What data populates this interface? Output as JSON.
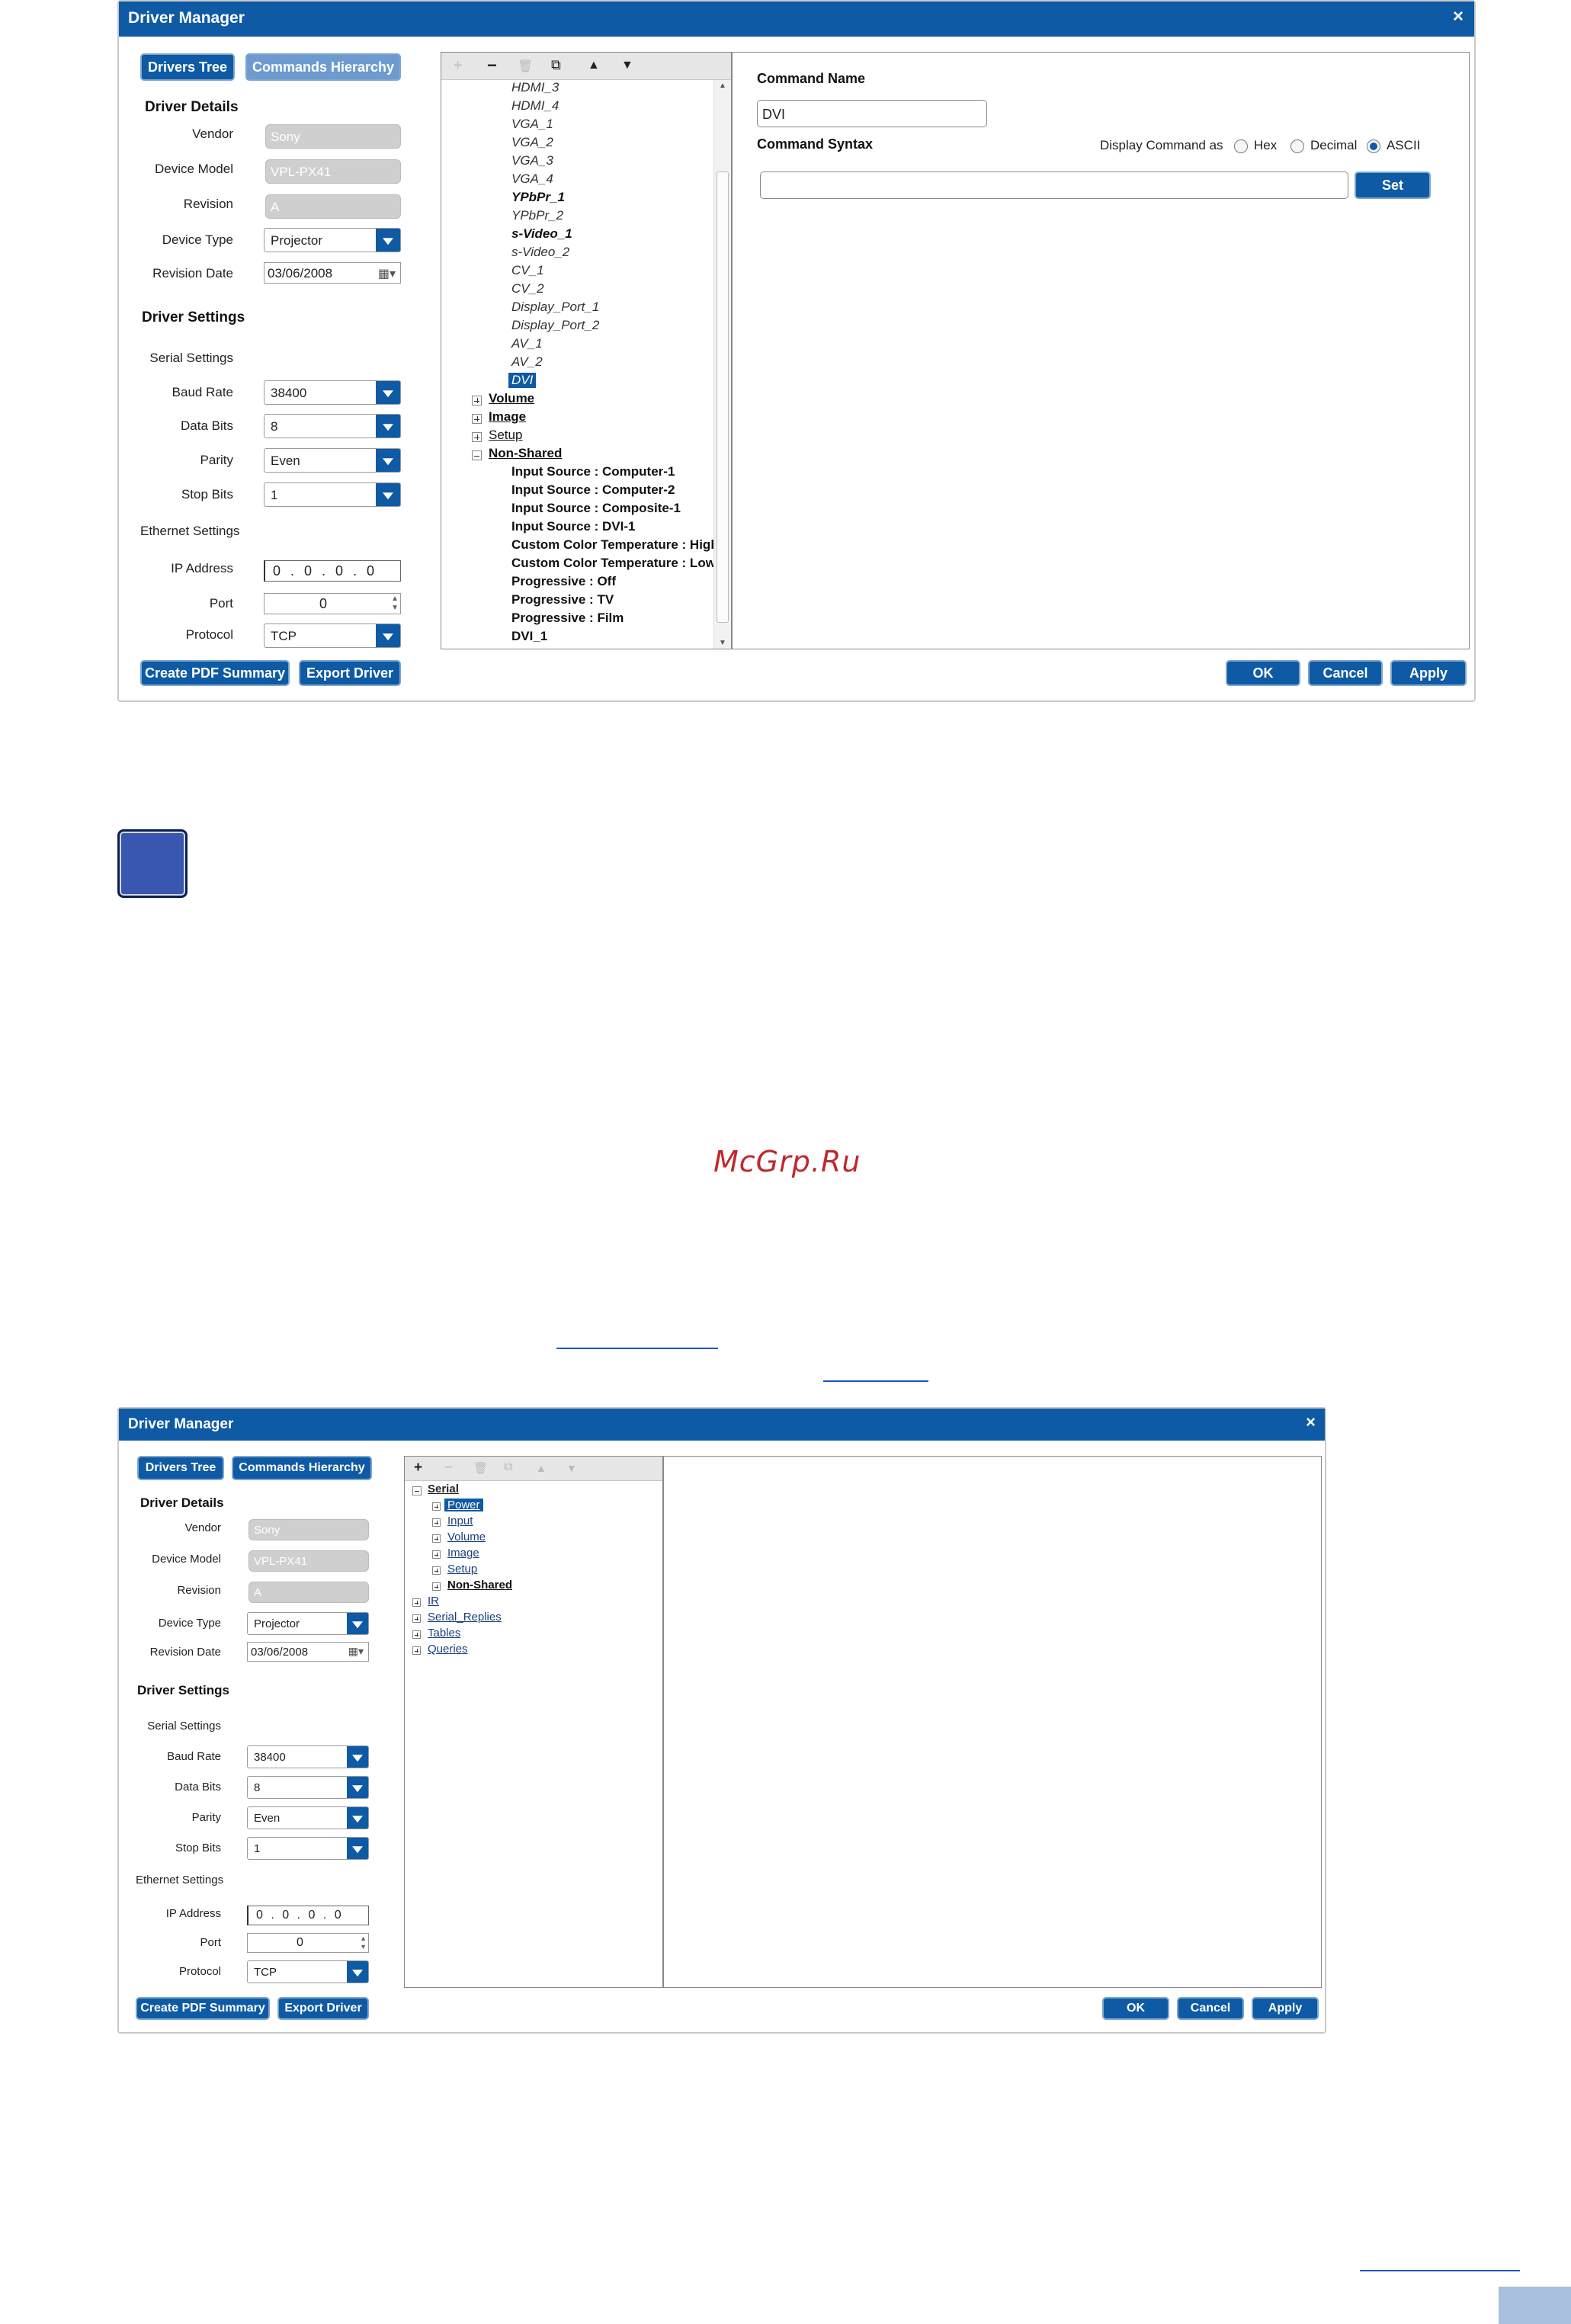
{
  "dialog1": {
    "title": "Driver Manager",
    "close": "×",
    "tabs": {
      "drivers_tree": "Drivers Tree",
      "commands_hierarchy": "Commands Hierarchy"
    },
    "driver_details": {
      "heading": "Driver Details",
      "vendor_label": "Vendor",
      "vendor_value": "Sony",
      "model_label": "Device Model",
      "model_value": "VPL-PX41",
      "revision_label": "Revision",
      "revision_value": "A",
      "type_label": "Device Type",
      "type_value": "Projector",
      "date_label": "Revision Date",
      "date_value": "03/06/2008"
    },
    "driver_settings": {
      "heading": "Driver Settings",
      "serial_label": "Serial Settings",
      "baud_label": "Baud Rate",
      "baud_value": "38400",
      "databits_label": "Data Bits",
      "databits_value": "8",
      "parity_label": "Parity",
      "parity_value": "Even",
      "stopbits_label": "Stop Bits",
      "stopbits_value": "1",
      "ethernet_label": "Ethernet Settings",
      "ip_label": "IP Address",
      "ip_value": "0 . 0 . 0 . 0",
      "port_label": "Port",
      "port_value": "0",
      "protocol_label": "Protocol",
      "protocol_value": "TCP"
    },
    "toolbar": {
      "add": "+",
      "remove": "−",
      "delete": "🗑",
      "copy": "⧉",
      "up": "▲",
      "down": "▼"
    },
    "tree_items": [
      {
        "label": "HDMI_3",
        "style": "italic"
      },
      {
        "label": "HDMI_4",
        "style": "italic"
      },
      {
        "label": "VGA_1",
        "style": "italic"
      },
      {
        "label": "VGA_2",
        "style": "italic"
      },
      {
        "label": "VGA_3",
        "style": "italic"
      },
      {
        "label": "VGA_4",
        "style": "italic"
      },
      {
        "label": "YPbPr_1",
        "style": "bolditalic"
      },
      {
        "label": "YPbPr_2",
        "style": "italic"
      },
      {
        "label": "s-Video_1",
        "style": "bolditalic"
      },
      {
        "label": "s-Video_2",
        "style": "italic"
      },
      {
        "label": "CV_1",
        "style": "italic"
      },
      {
        "label": "CV_2",
        "style": "italic"
      },
      {
        "label": "Display_Port_1",
        "style": "italic"
      },
      {
        "label": "Display_Port_2",
        "style": "italic"
      },
      {
        "label": "AV_1",
        "style": "italic"
      },
      {
        "label": "AV_2",
        "style": "italic"
      },
      {
        "label": "DVI",
        "style": "selected"
      }
    ],
    "tree_groups": [
      {
        "label": "Volume",
        "expander": "plus",
        "bold": true
      },
      {
        "label": "Image",
        "expander": "plus",
        "bold": true
      },
      {
        "label": "Setup",
        "expander": "plus",
        "bold": false
      },
      {
        "label": "Non-Shared",
        "expander": "minus",
        "bold": true
      }
    ],
    "nonshared_items": [
      "Input Source : Computer-1",
      "Input Source : Computer-2",
      "Input Source : Composite-1",
      "Input Source : DVI-1",
      "Custom Color Temperature : High",
      "Custom Color Temperature : Low",
      "Progressive : Off",
      "Progressive : TV",
      "Progressive : Film",
      "DVI_1"
    ],
    "command": {
      "name_label": "Command Name",
      "name_value": "DVI",
      "syntax_label": "Command Syntax",
      "display_as_label": "Display Command as",
      "hex": "Hex",
      "decimal": "Decimal",
      "ascii": "ASCII",
      "selected_format": "ASCII",
      "syntax_value": "",
      "set": "Set"
    },
    "bottom": {
      "pdf": "Create PDF Summary",
      "export": "Export Driver",
      "ok": "OK",
      "cancel": "Cancel",
      "apply": "Apply"
    }
  },
  "watermark": "McGrp.Ru",
  "dialog2": {
    "title": "Driver Manager",
    "close": "×",
    "tabs": {
      "drivers_tree": "Drivers Tree",
      "commands_hierarchy": "Commands Hierarchy"
    },
    "driver_details": {
      "heading": "Driver Details",
      "vendor_label": "Vendor",
      "vendor_value": "Sony",
      "model_label": "Device Model",
      "model_value": "VPL-PX41",
      "revision_label": "Revision",
      "revision_value": "A",
      "type_label": "Device Type",
      "type_value": "Projector",
      "date_label": "Revision Date",
      "date_value": "03/06/2008"
    },
    "driver_settings": {
      "heading": "Driver Settings",
      "serial_label": "Serial Settings",
      "baud_label": "Baud Rate",
      "baud_value": "38400",
      "databits_label": "Data Bits",
      "databits_value": "8",
      "parity_label": "Parity",
      "parity_value": "Even",
      "stopbits_label": "Stop Bits",
      "stopbits_value": "1",
      "ethernet_label": "Ethernet Settings",
      "ip_label": "IP Address",
      "ip_value": "0 . 0 . 0 . 0",
      "port_label": "Port",
      "port_value": "0",
      "protocol_label": "Protocol",
      "protocol_value": "TCP"
    },
    "toolbar": {
      "add": "+",
      "remove": "−",
      "delete": "🗑",
      "copy": "⧉",
      "up": "▲",
      "down": "▼"
    },
    "tree": {
      "serial": "Serial",
      "children": [
        "Power",
        "Input",
        "Volume",
        "Image",
        "Setup",
        "Non-Shared"
      ],
      "roots": [
        "IR",
        "Serial_Replies",
        "Tables",
        "Queries"
      ]
    },
    "bottom": {
      "pdf": "Create PDF Summary",
      "export": "Export Driver",
      "ok": "OK",
      "cancel": "Cancel",
      "apply": "Apply"
    }
  },
  "colors": {
    "accent": "#0e5aa4",
    "square": "#3a57b0",
    "watermark": "#c0282d",
    "link": "#1a56c4",
    "corner": "#a8c0de"
  }
}
